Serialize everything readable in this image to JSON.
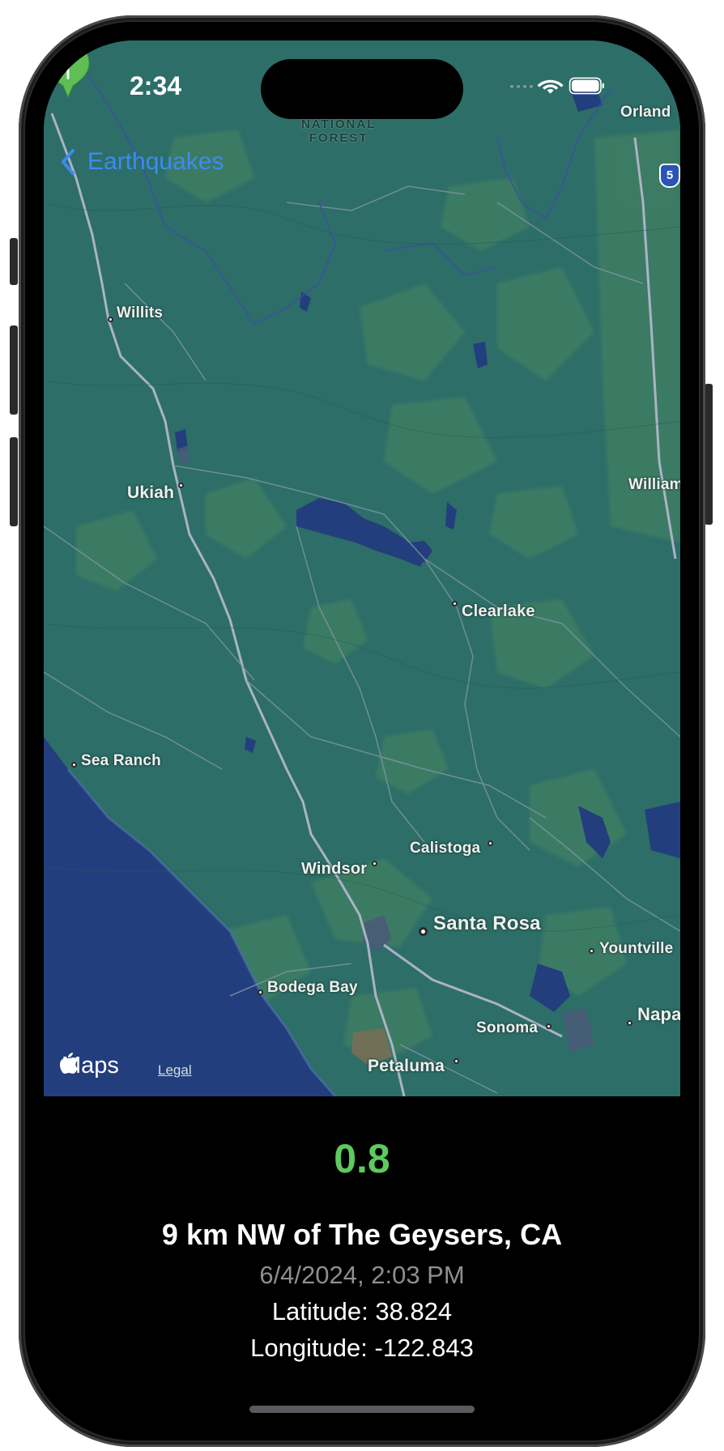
{
  "status_bar": {
    "time": "2:34"
  },
  "nav": {
    "back_label": "Earthquakes"
  },
  "map": {
    "labels": {
      "national_forest_1": "NATIONAL",
      "national_forest_2": "FOREST",
      "orland": "Orland",
      "highway": "5",
      "willits": "Willits",
      "ukiah": "Ukiah",
      "williams": "William",
      "clearlake": "Clearlake",
      "sea_ranch": "Sea Ranch",
      "calistoga": "Calistoga",
      "windsor": "Windsor",
      "santa_rosa": "Santa Rosa",
      "yountville": "Yountville",
      "bodega_bay": "Bodega Bay",
      "sonoma": "Sonoma",
      "napa": "Napa",
      "petaluma": "Petaluma"
    },
    "attribution": {
      "maps": "Maps",
      "legal": "Legal"
    },
    "pin_color": "#5fbf55"
  },
  "earthquake": {
    "magnitude": "0.8",
    "place": "9 km NW of The Geysers, CA",
    "time": "6/4/2024, 2:03 PM",
    "latitude": "Latitude: 38.824",
    "longitude": "Longitude: -122.843"
  },
  "colors": {
    "accent": "#3d8bf0",
    "magnitude": "#5ec95e",
    "land": "#2d6e68",
    "water": "#233e7c"
  }
}
